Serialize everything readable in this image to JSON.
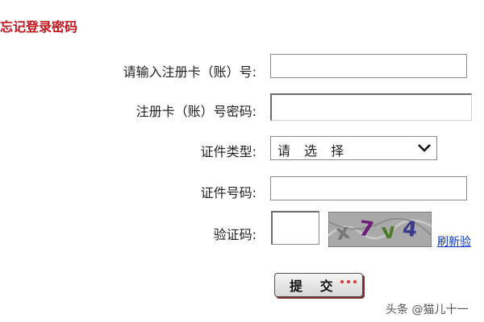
{
  "page": {
    "title": "忘记登录密码"
  },
  "form": {
    "card_label": "请输入注册卡（账）号:",
    "password_label": "注册卡（账）号密码:",
    "id_type_label": "证件类型:",
    "id_type_selected": "请 选 择",
    "id_number_label": "证件号码:",
    "captcha_label": "验证码:",
    "captcha_text": "x7v4",
    "refresh_link": "刷新验",
    "submit_label": "提 交"
  },
  "watermark": "头条 @猫儿十一",
  "icons": {
    "select_arrow": "chevron-down-icon",
    "submit_dots": "dots-icon"
  },
  "colors": {
    "title": "#c4141b",
    "link": "#0033cc",
    "border": "#8a8a8a"
  }
}
